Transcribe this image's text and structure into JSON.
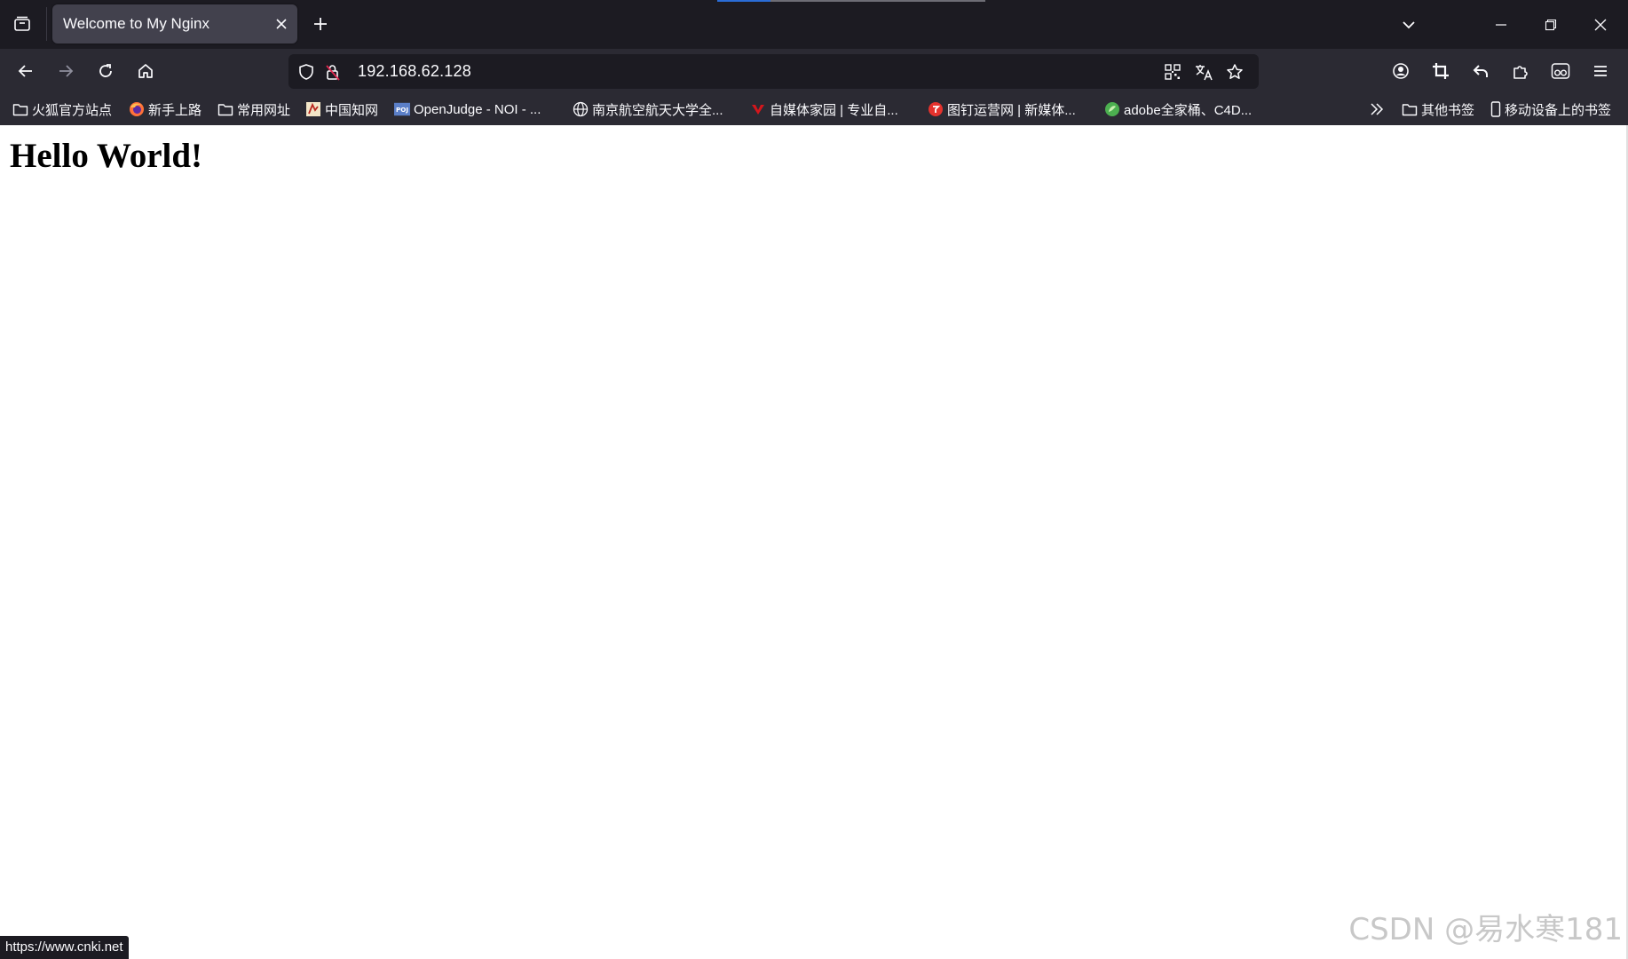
{
  "window": {
    "tab": {
      "title": "Welcome to My Nginx"
    },
    "colors": {
      "chrome": "#1c1b22",
      "toolbar": "#2b2a33",
      "tab_active": "#42414d",
      "accent": "#2a6cd6"
    }
  },
  "navigation": {
    "url": "192.168.62.128"
  },
  "bookmarks": {
    "items": [
      {
        "label": "火狐官方站点",
        "icon": "folder-icon"
      },
      {
        "label": "新手上路",
        "icon": "firefox-icon"
      },
      {
        "label": "常用网址",
        "icon": "folder-icon"
      },
      {
        "label": "中国知网",
        "icon": "cnki-icon"
      },
      {
        "label": "OpenJudge - NOI - ...",
        "icon": "poj-icon"
      },
      {
        "label": "南京航空航天大学全...",
        "icon": "globe-icon"
      },
      {
        "label": "自媒体家园 | 专业自...",
        "icon": "zmt-icon"
      },
      {
        "label": "图钉运营网 | 新媒体...",
        "icon": "tuding-icon"
      },
      {
        "label": "adobe全家桶、C4D...",
        "icon": "adobe-icon"
      }
    ],
    "other": {
      "label": "其他书签",
      "icon": "folder-icon"
    },
    "mobile": {
      "label": "移动设备上的书签",
      "icon": "mobile-icon"
    }
  },
  "page": {
    "heading": "Hello World!"
  },
  "status_bar": {
    "text": "https://www.cnki.net"
  },
  "watermark": {
    "text": "CSDN @易水寒181"
  }
}
